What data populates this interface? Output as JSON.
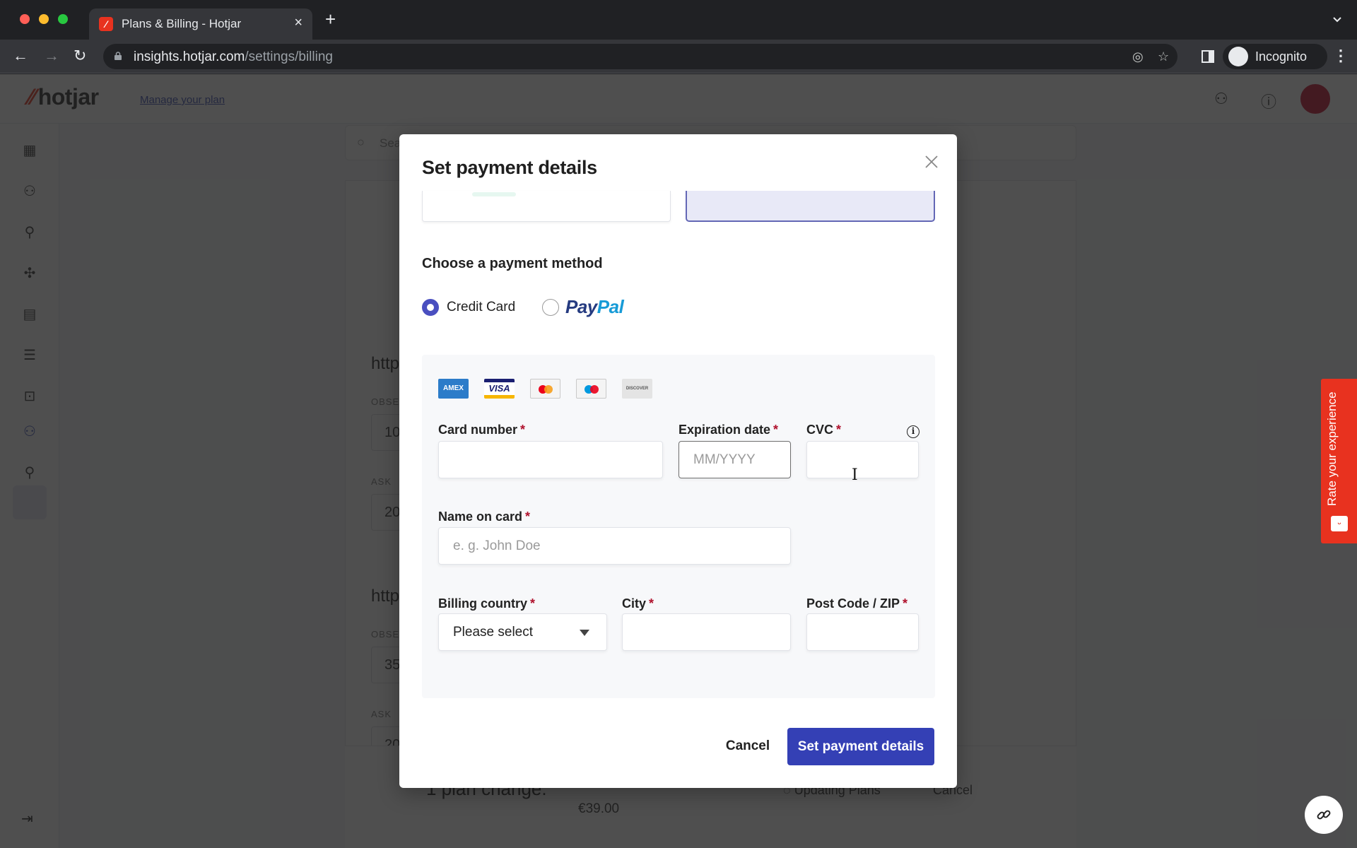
{
  "browser": {
    "tab_title": "Plans & Billing - Hotjar",
    "url_host": "insights.hotjar.com",
    "url_path": "/settings/billing",
    "profile_label": "Incognito"
  },
  "app": {
    "logo": "hotjar",
    "manage_link": "Manage your plan",
    "search_placeholder": "Search",
    "background_sites": [
      {
        "url": "http",
        "observe_label": "OBSE",
        "observe_value": "10",
        "ask_label": "ASK",
        "ask_value": "20"
      },
      {
        "url": "http",
        "observe_label": "OBSE",
        "observe_value": "35",
        "ask_label": "ASK",
        "ask_value": "20"
      }
    ],
    "bottom_bar": {
      "title": "1 plan change.",
      "price": "€39.00",
      "status": "Updating Plans",
      "cancel": "Cancel"
    },
    "feedback_tab": "Rate your experience"
  },
  "modal": {
    "title": "Set payment details",
    "payment_method_title": "Choose a payment method",
    "methods": [
      {
        "label": "Credit Card",
        "selected": true
      },
      {
        "label": "PayPal",
        "brand_part1": "Pay",
        "brand_part2": "Pal",
        "selected": false
      }
    ],
    "card_brands": [
      "AMEX",
      "VISA",
      "Mastercard",
      "Maestro",
      "DISCOVER"
    ],
    "fields": {
      "card_number": {
        "label": "Card number",
        "required": "*",
        "value": "",
        "placeholder": ""
      },
      "expiration": {
        "label": "Expiration date",
        "required": "*",
        "value": "",
        "placeholder": "MM/YYYY"
      },
      "cvc": {
        "label": "CVC",
        "required": "*",
        "value": "",
        "placeholder": ""
      },
      "name": {
        "label": "Name on card",
        "required": "*",
        "value": "",
        "placeholder": "e. g. John Doe"
      },
      "country": {
        "label": "Billing country",
        "required": "*",
        "selected": "Please select"
      },
      "city": {
        "label": "City",
        "required": "*",
        "value": "",
        "placeholder": ""
      },
      "zip": {
        "label": "Post Code / ZIP",
        "required": "*",
        "value": "",
        "placeholder": ""
      }
    },
    "cancel_label": "Cancel",
    "submit_label": "Set payment details"
  },
  "colors": {
    "primary": "#3440b5",
    "radio": "#4a4fc0",
    "required": "#b0122d",
    "brand_red": "#e8321f"
  }
}
